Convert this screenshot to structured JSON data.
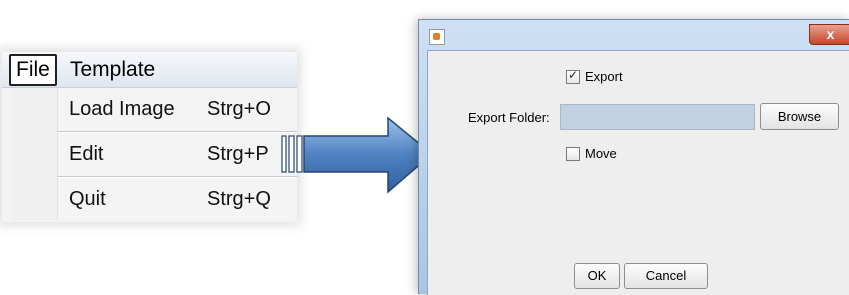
{
  "menubar": {
    "items": [
      {
        "label": "File"
      },
      {
        "label": "Template"
      }
    ]
  },
  "dropdown": {
    "items": [
      {
        "label": "Load Image",
        "accelerator": "Strg+O"
      },
      {
        "label": "Edit",
        "accelerator": "Strg+P"
      },
      {
        "label": "Quit",
        "accelerator": "Strg+Q"
      }
    ]
  },
  "dialog": {
    "title_icon": "java-app-icon",
    "close_label": "x",
    "export_checkbox": {
      "label": "Export",
      "checked": true
    },
    "export_folder": {
      "label": "Export Folder:",
      "value": ""
    },
    "browse_label": "Browse",
    "move_checkbox": {
      "label": "Move",
      "checked": false
    },
    "ok_label": "OK",
    "cancel_label": "Cancel"
  },
  "colors": {
    "arrow_fill": "#4f82c2",
    "dialog_frame": "#b7cfe9",
    "close_button": "#c7452c",
    "input_bg": "#c2d1e1"
  }
}
